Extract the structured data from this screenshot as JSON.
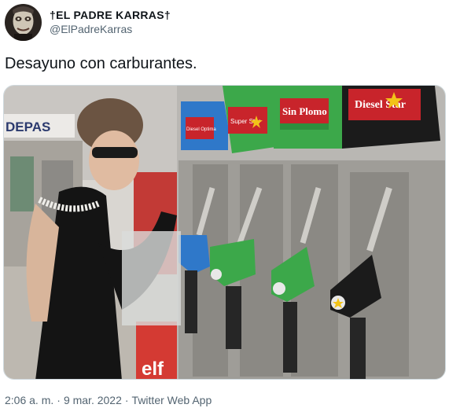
{
  "author": {
    "display_name": "†EL PADRE KARRAS†",
    "handle": "@ElPadreKarras"
  },
  "tweet": {
    "text": "Desayuno con carburantes."
  },
  "media": {
    "store_sign": "DEPAS",
    "pumps": [
      {
        "label": "Diesel Optima",
        "color": "#2f78c9"
      },
      {
        "label": "Super Star",
        "color": "#3ca84a"
      },
      {
        "label": "Sin Plomo",
        "color": "#3ca84a"
      },
      {
        "label": "Diesel Star",
        "color": "#1b1b1b"
      }
    ],
    "red_sign": "elf"
  },
  "meta": {
    "time": "2:06 a. m.",
    "date": "9 mar. 2022",
    "source": "Twitter Web App",
    "separator": "·"
  }
}
